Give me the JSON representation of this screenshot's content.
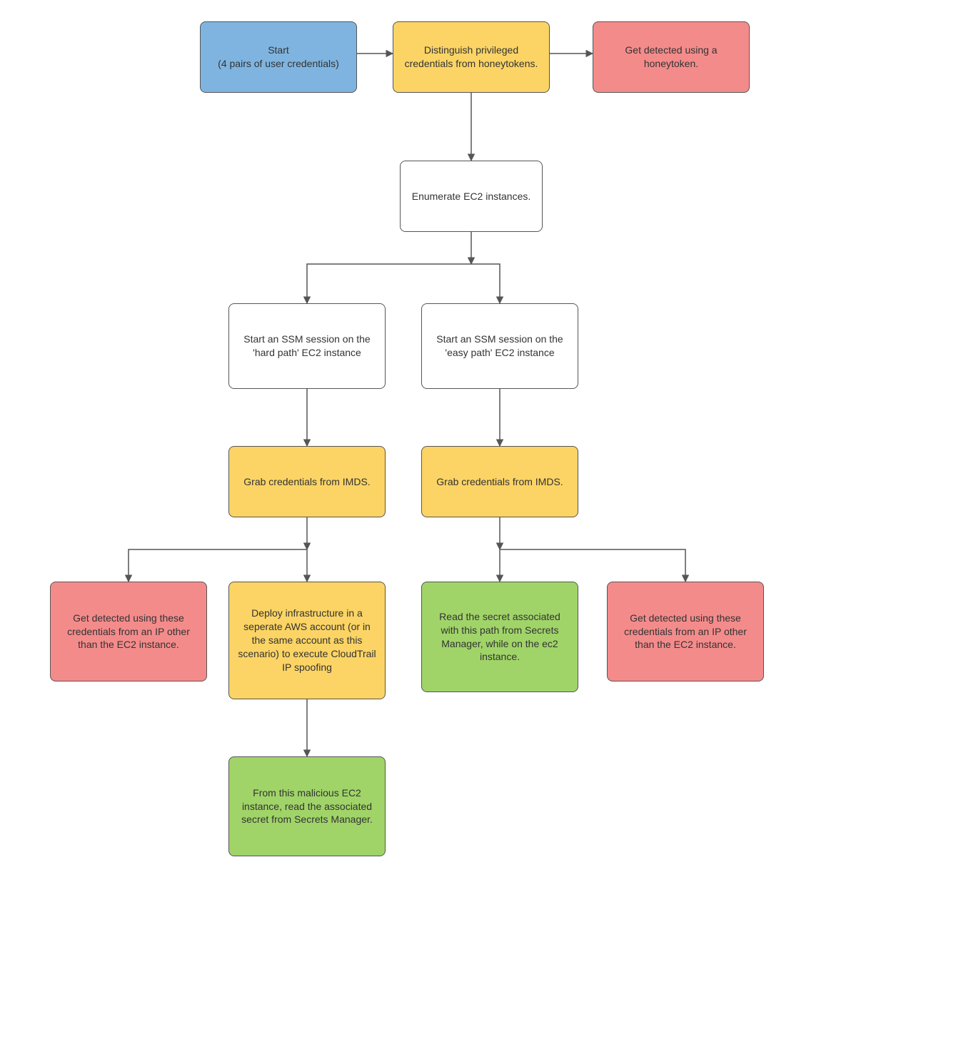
{
  "nodes": {
    "start": "Start\n(4 pairs of user credentials)",
    "distinguish": "Distinguish privileged credentials from honeytokens.",
    "detect_honeytoken": "Get detected using a honeytoken.",
    "enumerate": "Enumerate EC2 instances.",
    "ssm_hard": "Start an SSM session on the 'hard path' EC2 instance",
    "ssm_easy": "Start an SSM session on the 'easy path' EC2 instance",
    "imds_left": "Grab credentials from IMDS.",
    "imds_right": "Grab credentials from IMDS.",
    "detect_left": "Get detected using these credentials from an IP other than the EC2 instance.",
    "deploy_infra": "Deploy infrastructure in a seperate AWS account (or in the same account as this scenario) to execute CloudTrail IP spoofing",
    "read_secret_easy": "Read the secret associated with this path from Secrets Manager, while on the ec2 instance.",
    "detect_right": "Get detected using these credentials from an IP other than the EC2 instance.",
    "read_secret_hard": "From this malicious EC2 instance, read the associated secret from Secrets Manager."
  },
  "colors": {
    "blue": "#7fb4e0",
    "yellow": "#fbd465",
    "red": "#f48b8b",
    "green": "#a0d468",
    "white": "#ffffff",
    "border": "#555555"
  },
  "edges": [
    [
      "start",
      "distinguish"
    ],
    [
      "distinguish",
      "detect_honeytoken"
    ],
    [
      "distinguish",
      "enumerate"
    ],
    [
      "enumerate",
      "ssm_hard"
    ],
    [
      "enumerate",
      "ssm_easy"
    ],
    [
      "ssm_hard",
      "imds_left"
    ],
    [
      "ssm_easy",
      "imds_right"
    ],
    [
      "imds_left",
      "detect_left"
    ],
    [
      "imds_left",
      "deploy_infra"
    ],
    [
      "imds_right",
      "read_secret_easy"
    ],
    [
      "imds_right",
      "detect_right"
    ],
    [
      "deploy_infra",
      "read_secret_hard"
    ]
  ]
}
